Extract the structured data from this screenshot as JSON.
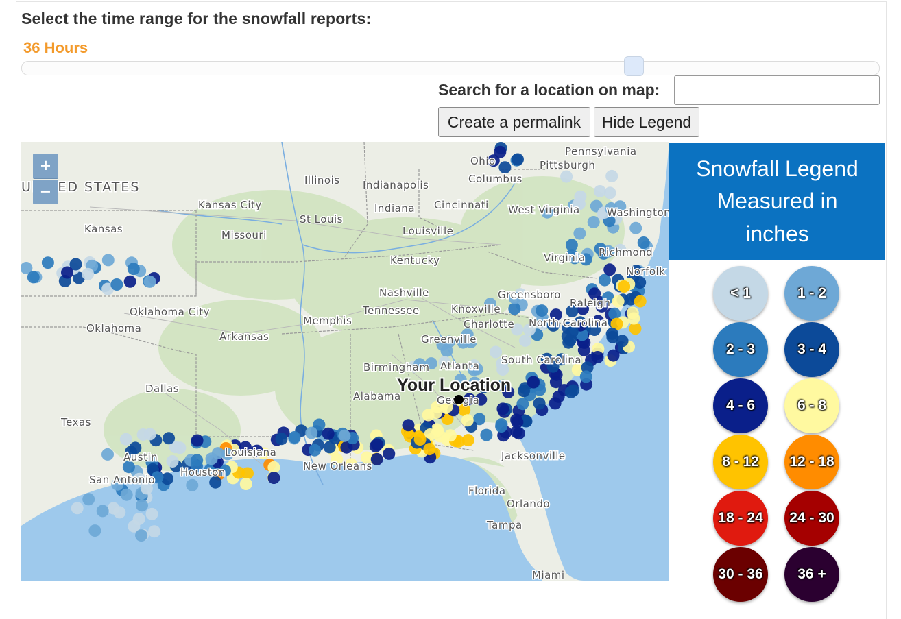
{
  "controls": {
    "heading": "Select the time range for the snowfall reports:",
    "range_value": "36 Hours",
    "slider_fraction": 0.715,
    "search_label": "Search for a location on map:",
    "search_value": "",
    "permalink_label": "Create a permalink",
    "hide_legend_label": "Hide Legend"
  },
  "map": {
    "zoom_in": "+",
    "zoom_out": "−",
    "your_location": "Your Location",
    "labels": [
      {
        "id": "united-states",
        "text": "UNITED STATES",
        "big": true
      },
      {
        "id": "kansas-city",
        "text": "Kansas City"
      },
      {
        "id": "kansas",
        "text": "Kansas"
      },
      {
        "id": "missouri",
        "text": "Missouri"
      },
      {
        "id": "st-louis",
        "text": "St Louis"
      },
      {
        "id": "illinois",
        "text": "Illinois"
      },
      {
        "id": "indianapolis",
        "text": "Indianapolis"
      },
      {
        "id": "indiana",
        "text": "Indiana"
      },
      {
        "id": "ohio",
        "text": "Ohio"
      },
      {
        "id": "columbus",
        "text": "Columbus"
      },
      {
        "id": "pittsburgh",
        "text": "Pittsburgh"
      },
      {
        "id": "pennsylvania",
        "text": "Pennsylvania"
      },
      {
        "id": "cincinnati",
        "text": "Cincinnati"
      },
      {
        "id": "louisville",
        "text": "Louisville"
      },
      {
        "id": "west-virginia",
        "text": "West Virginia"
      },
      {
        "id": "washington",
        "text": "Washington"
      },
      {
        "id": "kentucky",
        "text": "Kentucky"
      },
      {
        "id": "virginia",
        "text": "Virginia"
      },
      {
        "id": "richmond",
        "text": "Richmond"
      },
      {
        "id": "norfolk",
        "text": "Norfolk"
      },
      {
        "id": "nashville",
        "text": "Nashville"
      },
      {
        "id": "tennessee",
        "text": "Tennessee"
      },
      {
        "id": "knoxville",
        "text": "Knoxville"
      },
      {
        "id": "greensboro",
        "text": "Greensboro"
      },
      {
        "id": "raleigh",
        "text": "Raleigh"
      },
      {
        "id": "charlotte",
        "text": "Charlotte"
      },
      {
        "id": "north-carolina",
        "text": "North Carolina"
      },
      {
        "id": "oklahoma-city",
        "text": "Oklahoma City"
      },
      {
        "id": "oklahoma",
        "text": "Oklahoma"
      },
      {
        "id": "memphis",
        "text": "Memphis"
      },
      {
        "id": "arkansas",
        "text": "Arkansas"
      },
      {
        "id": "greenville",
        "text": "Greenville"
      },
      {
        "id": "birmingham",
        "text": "Birmingham"
      },
      {
        "id": "atlanta",
        "text": "Atlanta"
      },
      {
        "id": "south-carolina",
        "text": "South Carolina"
      },
      {
        "id": "alabama",
        "text": "Alabama"
      },
      {
        "id": "georgia",
        "text": "Georgia"
      },
      {
        "id": "dallas",
        "text": "Dallas"
      },
      {
        "id": "texas",
        "text": "Texas"
      },
      {
        "id": "louisiana",
        "text": "Louisiana"
      },
      {
        "id": "austin",
        "text": "Austin"
      },
      {
        "id": "houston",
        "text": "Houston"
      },
      {
        "id": "san-antonio",
        "text": "San Antonio"
      },
      {
        "id": "new-orleans",
        "text": "New Orleans"
      },
      {
        "id": "jacksonville",
        "text": "Jacksonville"
      },
      {
        "id": "florida",
        "text": "Florida"
      },
      {
        "id": "orlando",
        "text": "Orlando"
      },
      {
        "id": "tampa",
        "text": "Tampa"
      },
      {
        "id": "miami",
        "text": "Miami"
      }
    ]
  },
  "legend": {
    "title_line1": "Snowfall Legend",
    "title_line2": "Measured in",
    "title_line3": "inches",
    "bins": [
      {
        "label": "< 1",
        "color": "#c4d8e6"
      },
      {
        "label": "1 - 2",
        "color": "#6ea8d6"
      },
      {
        "label": "2 - 3",
        "color": "#2c7bbd"
      },
      {
        "label": "3 - 4",
        "color": "#0c4a99"
      },
      {
        "label": "4 - 6",
        "color": "#0a1f8a"
      },
      {
        "label": "6 - 8",
        "color": "#fff9a0"
      },
      {
        "label": "8 - 12",
        "color": "#ffc300"
      },
      {
        "label": "12 - 18",
        "color": "#ff8c00"
      },
      {
        "label": "18 - 24",
        "color": "#e01a0f"
      },
      {
        "label": "24 - 30",
        "color": "#a50000"
      },
      {
        "label": "30 - 36",
        "color": "#6b0000"
      },
      {
        "label": "36 +",
        "color": "#2b0030"
      }
    ]
  }
}
